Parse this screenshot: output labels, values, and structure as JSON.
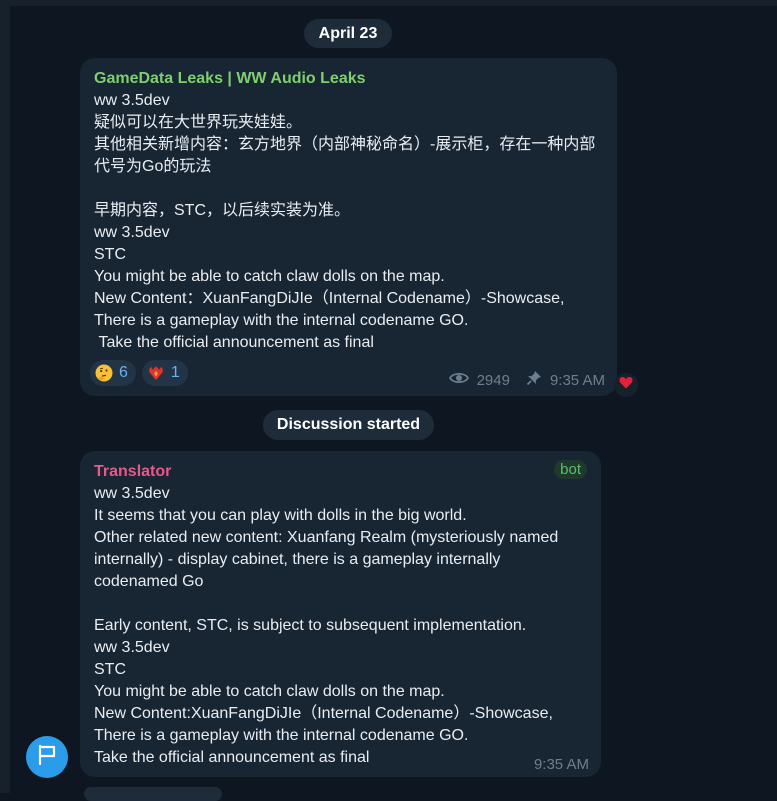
{
  "date_label": "April 23",
  "service_label": "Discussion started",
  "post": {
    "channel": "GameData Leaks | WW Audio Leaks",
    "text": "ww 3.5dev\n疑似可以在大世界玩夹娃娃。\n其他相关新增内容：玄方地界（内部神秘命名）-展示柜，存在一种内部\n代号为Go的玩法\n\n早期内容，STC，以后续实装为准。\nww 3.5dev\nSTC\nYou might be able to catch claw dolls on the map.\nNew Content：XuanFangDiJIe（Internal Codename）-Showcase,\nThere is a gameplay with the internal codename GO.\n Take the official announcement as final",
    "reactions": [
      {
        "icon": "thinking-face-icon",
        "count": "6"
      },
      {
        "icon": "heart-on-fire-icon",
        "count": "1"
      }
    ],
    "views": "2949",
    "time": "9:35 AM",
    "side_reaction_icon": "red-heart-icon"
  },
  "reply": {
    "sender": "Translator",
    "badge": "bot",
    "text": "ww 3.5dev\nIt seems that you can play with dolls in the big world.\nOther related new content: Xuanfang Realm (mysteriously named\ninternally) - display cabinet, there is a gameplay internally\ncodenamed Go\n\nEarly content, STC, is subject to subsequent implementation.\nww 3.5dev\nSTC\nYou might be able to catch claw dolls on the map.\nNew Content:XuanFangDiJIe（Internal Codename）-Showcase,\nThere is a gameplay with the internal codename GO.\nTake the official announcement as final",
    "time": "9:35 AM"
  },
  "colors": {
    "background": "#0e1621",
    "bubble": "#182533",
    "channel_name": "#7ecf6e",
    "translator_name": "#e8588b",
    "accent": "#2b9ce9"
  }
}
